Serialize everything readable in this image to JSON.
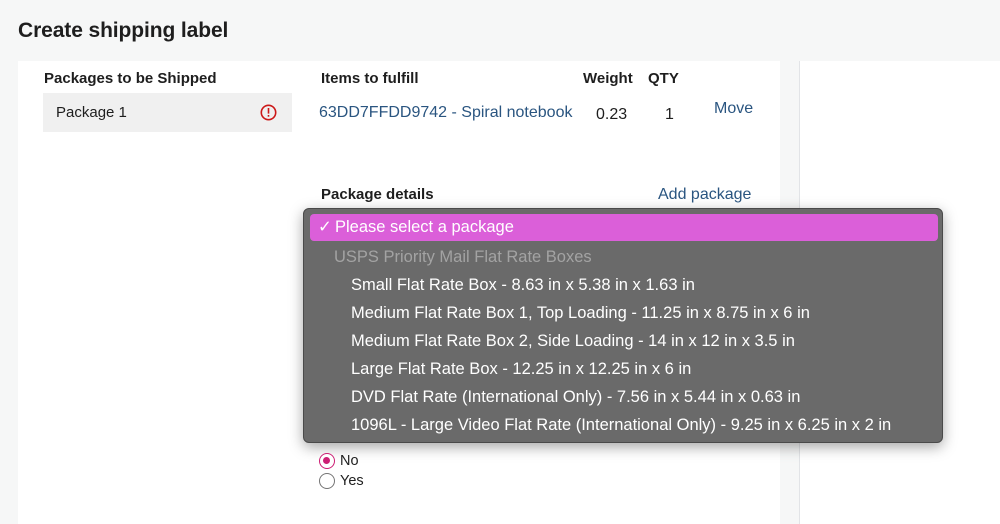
{
  "page": {
    "title": "Create shipping label"
  },
  "packages": {
    "header": "Packages to be Shipped",
    "items": [
      {
        "name": "Package 1",
        "status_icon": "alert-circle-icon"
      }
    ]
  },
  "items_table": {
    "headers": {
      "items": "Items to fulfill",
      "weight": "Weight",
      "qty": "QTY"
    },
    "rows": [
      {
        "item": "63DD7FFDD9742 - Spiral notebook",
        "weight": "0.23",
        "qty": "1",
        "action": "Move"
      }
    ]
  },
  "package_details": {
    "label": "Package details",
    "add_package": "Add package"
  },
  "package_select": {
    "selected": "Please select a package",
    "check": "✓",
    "group_label": "USPS Priority Mail Flat Rate Boxes",
    "options": [
      "Small Flat Rate Box - 8.63 in x 5.38 in x 1.63 in",
      "Medium Flat Rate Box 1, Top Loading - 11.25 in x 8.75 in x 6 in",
      "Medium Flat Rate Box 2, Side Loading - 14 in x 12 in x 3.5 in",
      "Large Flat Rate Box - 12.25 in x 12.25 in x 6 in",
      "DVD Flat Rate (International Only) - 7.56 in x 5.44 in x 0.63 in",
      "1096L - Large Video Flat Rate (International Only) - 9.25 in x 6.25 in x 2 in"
    ]
  },
  "radio_group": {
    "selected": "No",
    "options": [
      "No",
      "Yes"
    ]
  },
  "colors": {
    "accent": "#cc1f74",
    "link": "#2a5580",
    "dropdown_highlight": "#db5fd9",
    "dropdown_bg": "#6a6a6a",
    "alert": "#cc1818"
  }
}
